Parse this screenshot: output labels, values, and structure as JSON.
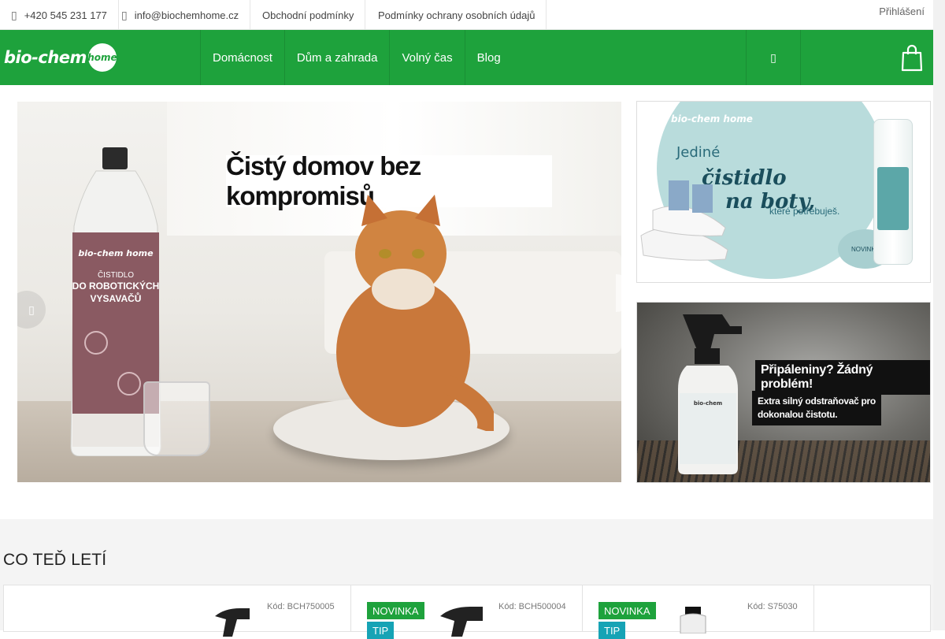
{
  "topbar": {
    "phone": "+420 545 231 177",
    "email": "info@biochemhome.cz",
    "terms": "Obchodní podmínky",
    "privacy": "Podmínky ochrany osobních údajů",
    "login": "Přihlášení"
  },
  "header": {
    "logo_text": "bio-chem",
    "logo_badge": "home",
    "nav": [
      "Domácnost",
      "Dům a zahrada",
      "Volný čas",
      "Blog"
    ]
  },
  "hero": {
    "main_headline": "Čistý domov bez kompromisů",
    "bottle_brand": "bio-chem home",
    "bottle_title_1": "ČISTIDLO",
    "bottle_title_2": "DO ROBOTICKÝCH",
    "bottle_title_3": "VYSAVAČŮ",
    "banner1": {
      "logo": "bio-chem home",
      "line1": "Jediné",
      "line2": "čistidlo",
      "line3": "na boty,",
      "line4": "které potřebuješ.",
      "badge": "NOVINKA"
    },
    "banner2": {
      "headline": "Připáleniny? Žádný problém!",
      "sub1": "Extra silný odstraňovač pro",
      "sub2": "dokonalou čistotu."
    }
  },
  "section": {
    "title": "CO TEĎ LETÍ",
    "cards": [
      {
        "code": "Kód: BCH750005",
        "badges": []
      },
      {
        "code": "Kód: BCH500004",
        "badges": [
          "NOVINKA",
          "TIP"
        ]
      },
      {
        "code": "Kód: S75030",
        "badges": [
          "NOVINKA",
          "TIP"
        ]
      }
    ]
  },
  "colors": {
    "brand_green": "#1ea23c",
    "tip_teal": "#16a3b5"
  }
}
